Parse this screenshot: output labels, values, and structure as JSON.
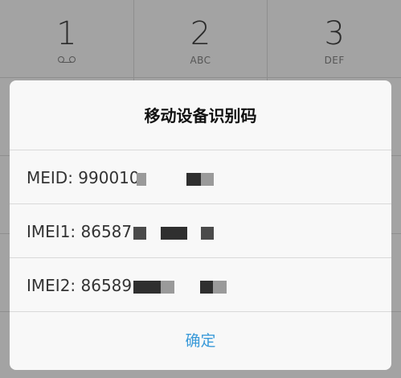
{
  "dialpad": {
    "keys": [
      {
        "digit": "1",
        "sub": "voicemail-icon"
      },
      {
        "digit": "2",
        "sub": "ABC"
      },
      {
        "digit": "3",
        "sub": "DEF"
      }
    ]
  },
  "dialog": {
    "title": "移动设备识别码",
    "rows": [
      {
        "text": "MEID: 990010"
      },
      {
        "text": "IMEI1: 86587"
      },
      {
        "text": "IMEI2: 86589"
      }
    ],
    "confirm_label": "确定"
  },
  "colors": {
    "accent": "#3a9ad9",
    "mask_dark": "#2f2f2f",
    "mask_light": "#9a9a9a"
  }
}
